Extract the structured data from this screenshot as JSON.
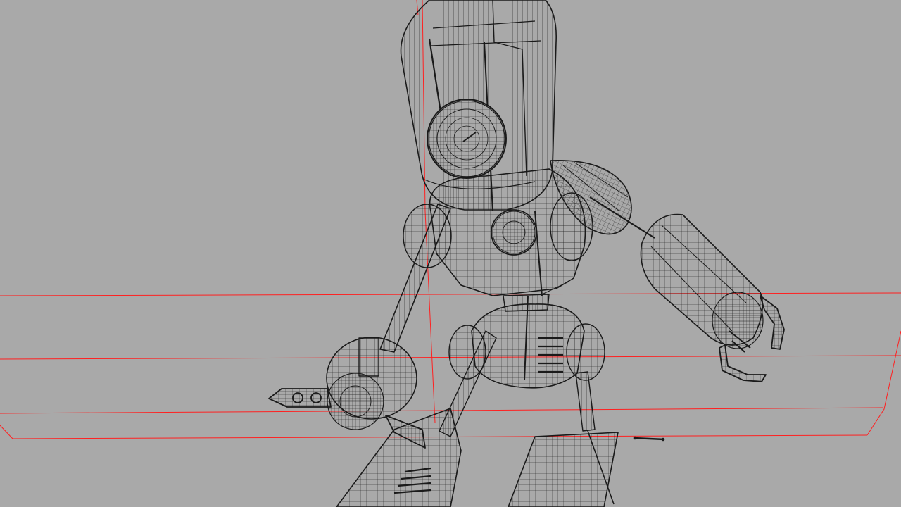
{
  "viewport": {
    "background_color": "#a9a9a9",
    "wire_color": "#1a1a1a",
    "grid_color": "#ff2020",
    "shading_mode": "wireframe"
  }
}
